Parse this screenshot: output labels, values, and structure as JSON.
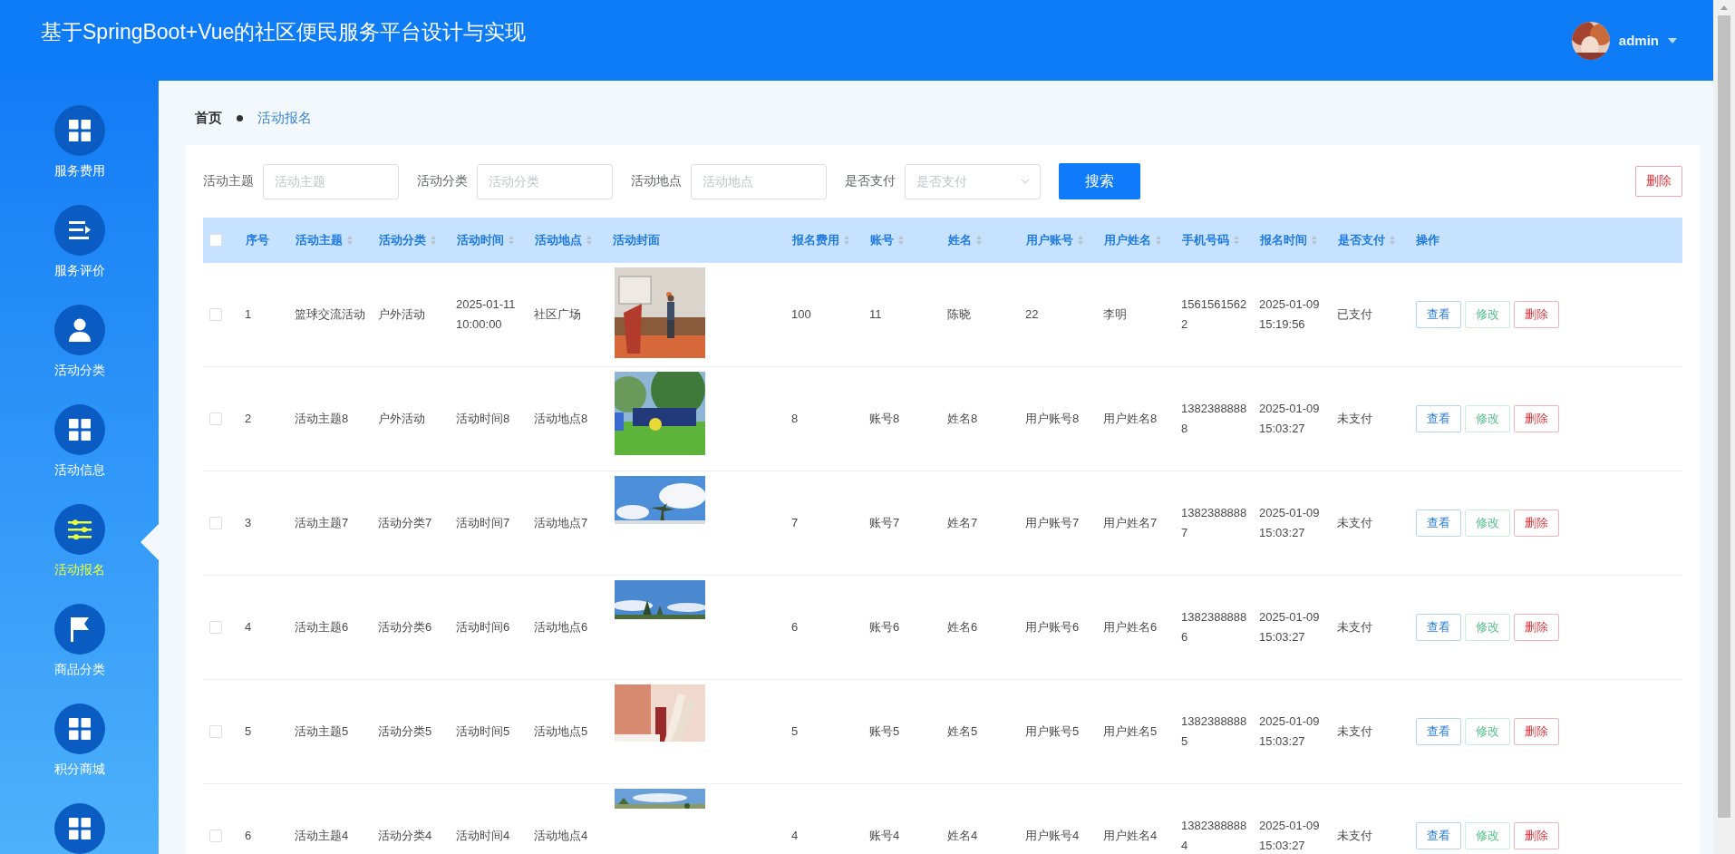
{
  "header": {
    "title": "基于SpringBoot+Vue的社区便民服务平台设计与实现",
    "user": "admin"
  },
  "sidebar": {
    "items": [
      {
        "label": "服务费用",
        "selected": false
      },
      {
        "label": "服务评价",
        "selected": false
      },
      {
        "label": "活动分类",
        "selected": false
      },
      {
        "label": "活动信息",
        "selected": false
      },
      {
        "label": "活动报名",
        "selected": true
      },
      {
        "label": "商品分类",
        "selected": false
      },
      {
        "label": "积分商城",
        "selected": false
      },
      {
        "selected": false
      }
    ]
  },
  "breadcrumb": [
    "首页",
    "活动报名"
  ],
  "filters": [
    {
      "label": "活动主题",
      "placeholder": "活动主题",
      "kind": "input"
    },
    {
      "label": "活动分类",
      "placeholder": "活动分类",
      "kind": "input"
    },
    {
      "label": "活动地点",
      "placeholder": "活动地点",
      "kind": "input"
    },
    {
      "label": "是否支付",
      "placeholder": "是否支付",
      "kind": "select"
    }
  ],
  "search_button": "搜索",
  "delete_button": "删除",
  "table": {
    "select_all": {
      "checked": false
    },
    "columns": [
      {
        "label": "序号",
        "sortable": false
      },
      {
        "label": "活动主题",
        "sortable": true
      },
      {
        "label": "活动分类",
        "sortable": true
      },
      {
        "label": "活动时间",
        "sortable": true
      },
      {
        "label": "活动地点",
        "sortable": true
      },
      {
        "label": "活动封面",
        "sortable": false
      },
      {
        "label": "报名费用",
        "sortable": true
      },
      {
        "label": "账号",
        "sortable": true
      },
      {
        "label": "姓名",
        "sortable": true
      },
      {
        "label": "用户账号",
        "sortable": true
      },
      {
        "label": "用户姓名",
        "sortable": true
      },
      {
        "label": "手机号码",
        "sortable": true
      },
      {
        "label": "报名时间",
        "sortable": true
      },
      {
        "label": "是否支付",
        "sortable": true
      },
      {
        "label": "操作",
        "sortable": false
      }
    ],
    "rows": [
      {
        "checked": false,
        "cells": [
          "1",
          "篮球交流活动",
          "户外活动",
          "2025-01-11 10:00:00",
          "社区广场",
          "",
          "100",
          "11",
          "陈晓",
          "22",
          "李明",
          "15615615622",
          "2025-01-09 15:19:56",
          "已支付"
        ],
        "actions": [
          "查看",
          "修改",
          "删除"
        ]
      },
      {
        "checked": false,
        "cells": [
          "2",
          "活动主题8",
          "户外活动",
          "活动时间8",
          "活动地点8",
          "",
          "8",
          "账号8",
          "姓名8",
          "用户账号8",
          "用户姓名8",
          "13823888888",
          "2025-01-09 15:03:27",
          "未支付"
        ],
        "actions": [
          "查看",
          "修改",
          "删除"
        ]
      },
      {
        "checked": false,
        "cells": [
          "3",
          "活动主题7",
          "活动分类7",
          "活动时间7",
          "活动地点7",
          "",
          "7",
          "账号7",
          "姓名7",
          "用户账号7",
          "用户姓名7",
          "13823888887",
          "2025-01-09 15:03:27",
          "未支付"
        ],
        "actions": [
          "查看",
          "修改",
          "删除"
        ]
      },
      {
        "checked": false,
        "cells": [
          "4",
          "活动主题6",
          "活动分类6",
          "活动时间6",
          "活动地点6",
          "",
          "6",
          "账号6",
          "姓名6",
          "用户账号6",
          "用户姓名6",
          "13823888886",
          "2025-01-09 15:03:27",
          "未支付"
        ],
        "actions": [
          "查看",
          "修改",
          "删除"
        ]
      },
      {
        "checked": false,
        "cells": [
          "5",
          "活动主题5",
          "活动分类5",
          "活动时间5",
          "活动地点5",
          "",
          "5",
          "账号5",
          "姓名5",
          "用户账号5",
          "用户姓名5",
          "13823888885",
          "2025-01-09 15:03:27",
          "未支付"
        ],
        "actions": [
          "查看",
          "修改",
          "删除"
        ]
      },
      {
        "checked": false,
        "cells": [
          "6",
          "活动主题4",
          "活动分类4",
          "活动时间4",
          "活动地点4",
          "",
          "4",
          "账号4",
          "姓名4",
          "用户账号4",
          "用户姓名4",
          "13823888884",
          "2025-01-09 15:03:27",
          "未支付"
        ],
        "actions": [
          "查看",
          "修改",
          "删除"
        ]
      }
    ]
  }
}
